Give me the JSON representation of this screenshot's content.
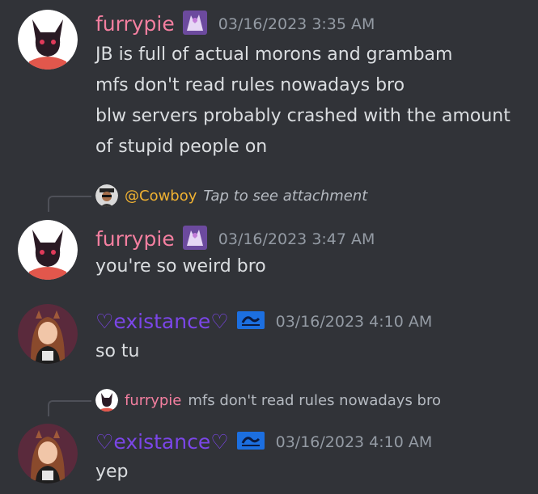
{
  "messages": [
    {
      "author": "furrypie",
      "timestamp": "03/16/2023 3:35 AM",
      "lines": [
        "JB is full of actual morons and grambam",
        "mfs don't read rules nowadays bro",
        "blw servers probably crashed with the amount",
        "of stupid people on"
      ]
    },
    {
      "reply": {
        "author": "@Cowboy",
        "hint": "Tap to see attachment"
      },
      "author": "furrypie",
      "timestamp": "03/16/2023 3:47 AM",
      "lines": [
        "you're so weird bro"
      ]
    },
    {
      "author": "♡existance♡",
      "timestamp": "03/16/2023 4:10 AM",
      "lines": [
        "so tu"
      ]
    },
    {
      "reply": {
        "author": "furrypie",
        "text": "mfs don't read rules nowadays bro"
      },
      "author": "♡existance♡",
      "timestamp": "03/16/2023 4:10 AM",
      "lines": [
        "yep"
      ]
    }
  ],
  "colors": {
    "background": "#313338",
    "furrypie_name": "#f47fa0",
    "existance_name": "#7b46e8",
    "cowboy_name": "#f0b232",
    "timestamp": "#949ba4",
    "text": "#dbdee1"
  },
  "icons": {
    "furrypie_avatar": "black-fox-avatar-icon",
    "existance_avatar": "girl-avatar-icon",
    "furrypie_tag": "purple-art-badge-icon",
    "existance_tag": "blue-swirl-badge-icon",
    "cowboy_avatar": "cowboy-avatar-icon"
  }
}
